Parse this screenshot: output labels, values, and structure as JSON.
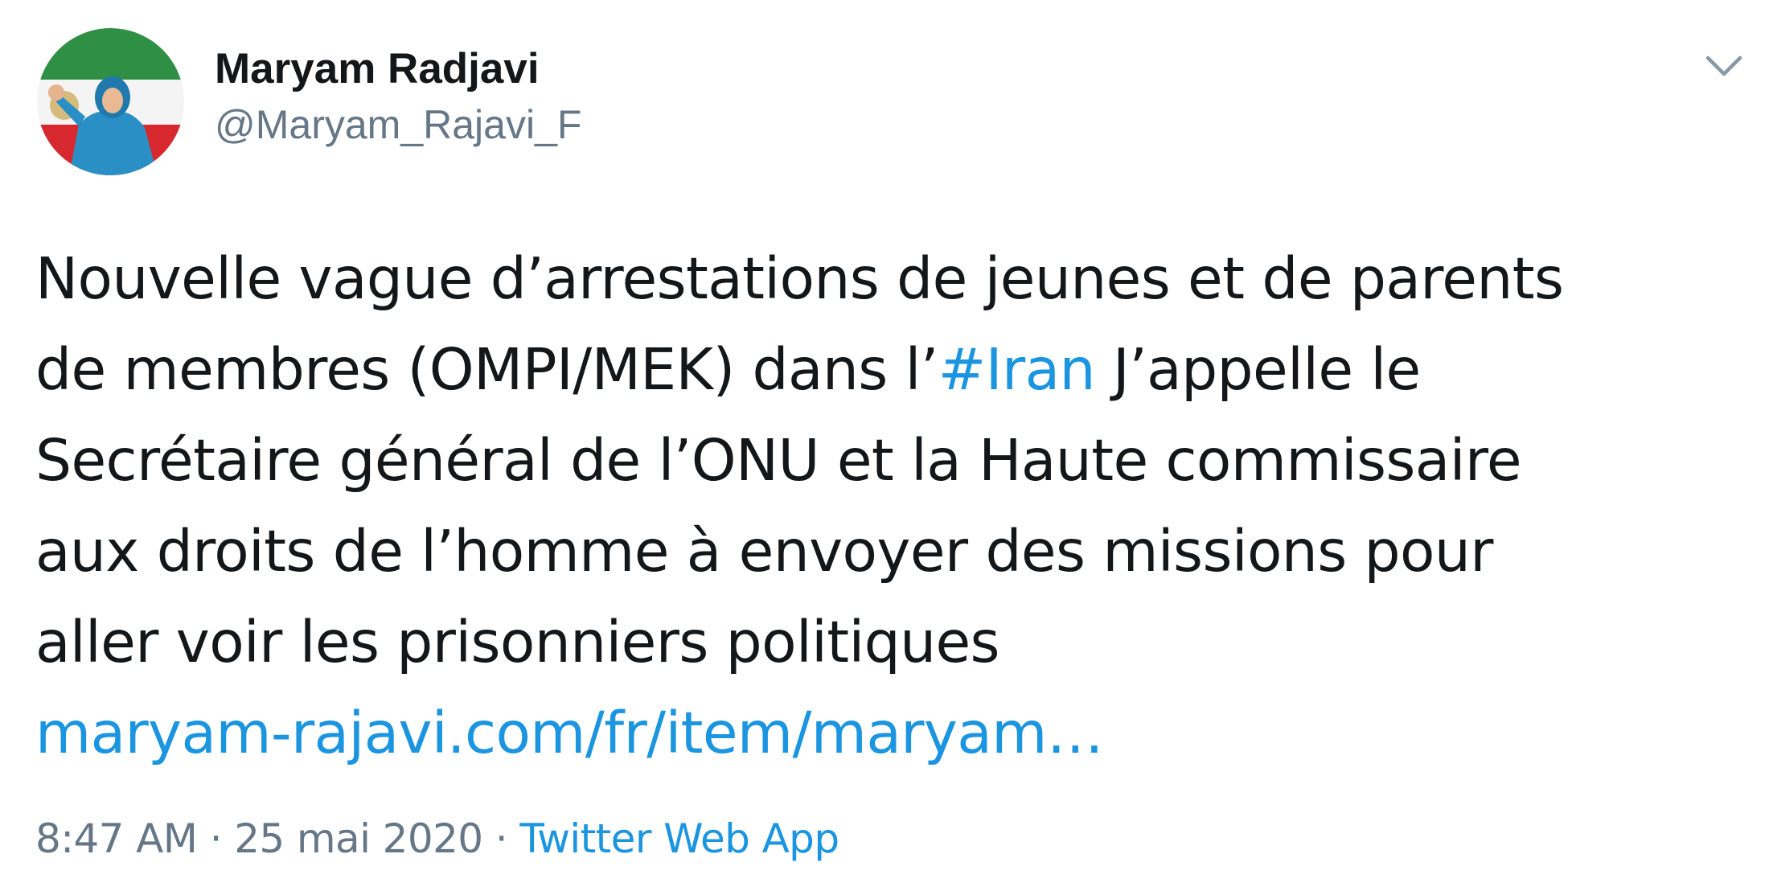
{
  "author": {
    "display_name": "Maryam Radjavi",
    "handle": "@Maryam_Rajavi_F"
  },
  "menu": {
    "caret_icon": "chevron-down-icon"
  },
  "tweet": {
    "line1": "Nouvelle vague d’arrestations de jeunes et de parents",
    "line2_before": "de membres (OMPI/MEK) dans l’",
    "line2_hashtag": "#Iran",
    "line2_after": " J’appelle le",
    "line3": "Secrétaire général de l’ONU et la Haute commissaire",
    "line4": "aux droits de l’homme à envoyer des missions pour",
    "line5": "aller voir les prisonniers politiques",
    "url": "maryam-rajavi.com/fr/item/maryam…"
  },
  "meta": {
    "time": "8:47 AM",
    "separator": " · ",
    "date": "25 mai 2020",
    "source": "Twitter Web App"
  },
  "colors": {
    "text": "#14171a",
    "secondary": "#657786",
    "link": "#1b95e0",
    "background": "#ffffff"
  }
}
